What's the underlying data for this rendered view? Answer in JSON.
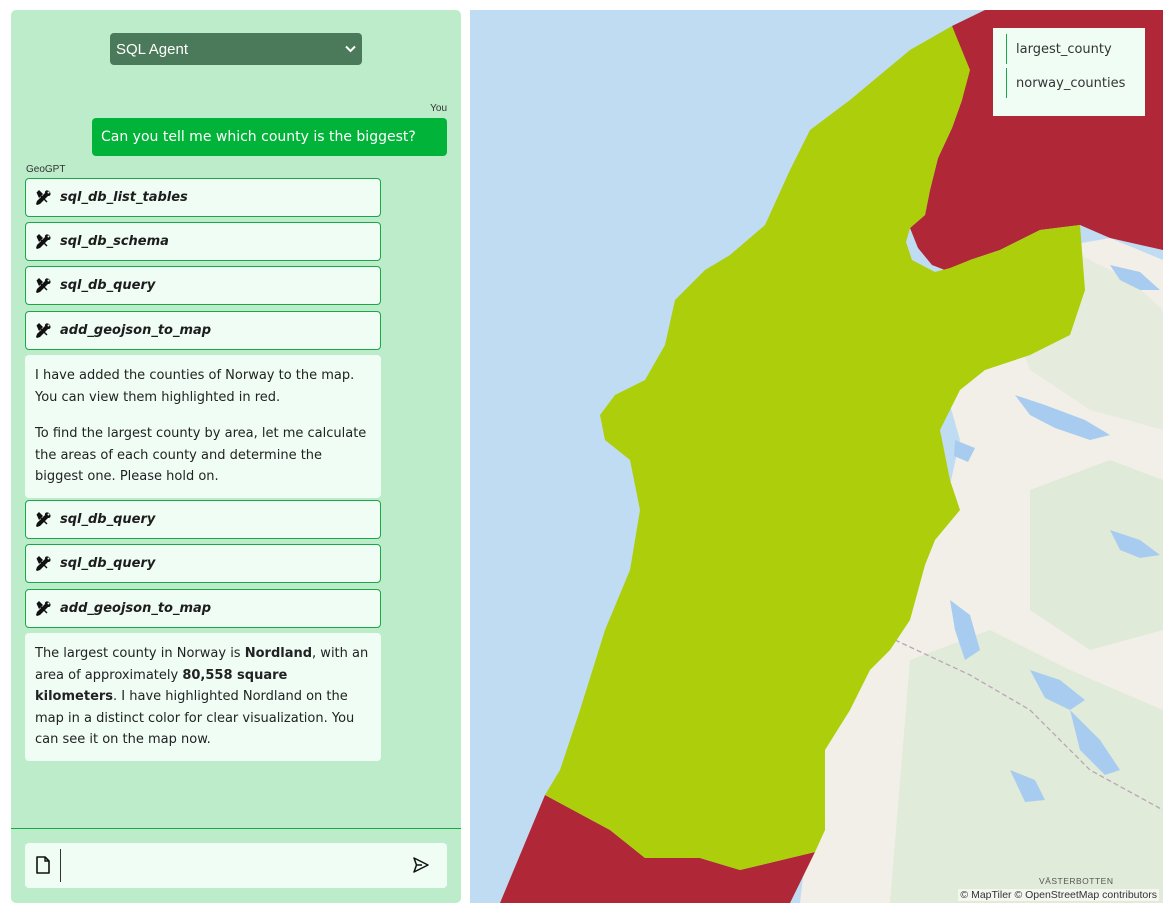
{
  "agent_select": {
    "value": "SQL Agent"
  },
  "chat": {
    "user_label": "You",
    "user_message": "Can you tell me which county is the biggest?",
    "bot_label": "GeoGPT",
    "tool_calls": [
      "sql_db_list_tables",
      "sql_db_schema",
      "sql_db_query",
      "add_geojson_to_map",
      "sql_db_query",
      "sql_db_query",
      "add_geojson_to_map"
    ],
    "message_1": {
      "p1": "I have added the counties of Norway to the map. You can view them highlighted in red.",
      "p2": "To find the largest county by area, let me calculate the areas of each county and determine the biggest one. Please hold on."
    },
    "message_2": {
      "part1": "The largest county in Norway is ",
      "county": "Nordland",
      "part2": ", with an area of approximately ",
      "area": "80,558 square kilometers",
      "part3": ". I have highlighted Nordland on the map in a distinct color for clear visualization. You can see it on the map now."
    }
  },
  "input": {
    "value": ""
  },
  "map": {
    "legend": [
      "largest_county",
      "norway_counties"
    ],
    "region_label": "VÄSTERBOTTEN",
    "attribution": "© MapTiler © OpenStreetMap contributors",
    "colors": {
      "sea": "#c0dcf2",
      "land": "#f2efe9",
      "forest": "#dbe9d3",
      "largest_county": "#adce0a",
      "norway_counties": "#b02738",
      "lake": "#a8ccef"
    }
  }
}
